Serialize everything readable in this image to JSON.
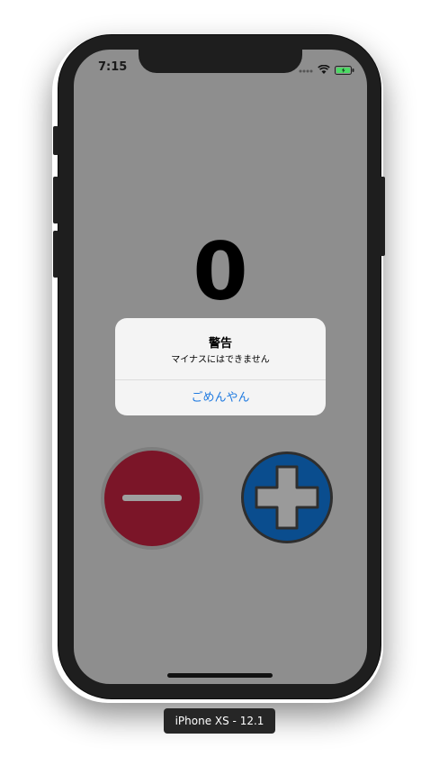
{
  "status_bar": {
    "time": "7:15",
    "battery_color": "#4cd964"
  },
  "counter": {
    "value": "0"
  },
  "alert": {
    "title": "警告",
    "message": "マイナスにはできません",
    "button_label": "ごめんやん"
  },
  "buttons": {
    "minus_icon": "minus-icon",
    "plus_icon": "plus-icon",
    "minus_color": "#7b1528",
    "plus_color": "#0a4d8e"
  },
  "device_label": "iPhone XS - 12.1"
}
